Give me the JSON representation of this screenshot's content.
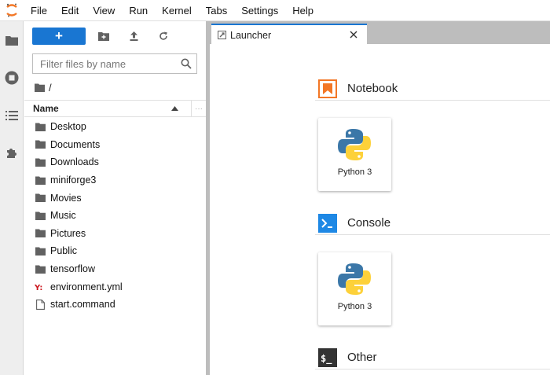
{
  "menu": [
    "File",
    "Edit",
    "View",
    "Run",
    "Kernel",
    "Tabs",
    "Settings",
    "Help"
  ],
  "filebrowser": {
    "new_label": "+",
    "filter_placeholder": "Filter files by name",
    "breadcrumb": "/",
    "column_name": "Name",
    "files": [
      {
        "name": "Desktop",
        "type": "folder"
      },
      {
        "name": "Documents",
        "type": "folder"
      },
      {
        "name": "Downloads",
        "type": "folder"
      },
      {
        "name": "miniforge3",
        "type": "folder"
      },
      {
        "name": "Movies",
        "type": "folder"
      },
      {
        "name": "Music",
        "type": "folder"
      },
      {
        "name": "Pictures",
        "type": "folder"
      },
      {
        "name": "Public",
        "type": "folder"
      },
      {
        "name": "tensorflow",
        "type": "folder"
      },
      {
        "name": "environment.yml",
        "type": "yaml"
      },
      {
        "name": "start.command",
        "type": "file"
      }
    ]
  },
  "tab": {
    "label": "Launcher"
  },
  "launcher": {
    "notebook": {
      "title": "Notebook",
      "card": "Python 3"
    },
    "console": {
      "title": "Console",
      "card": "Python 3"
    },
    "other": {
      "title": "Other"
    }
  },
  "colors": {
    "accent": "#1976d2",
    "jupyter_orange": "#f37726",
    "yaml": "#cb171e"
  }
}
